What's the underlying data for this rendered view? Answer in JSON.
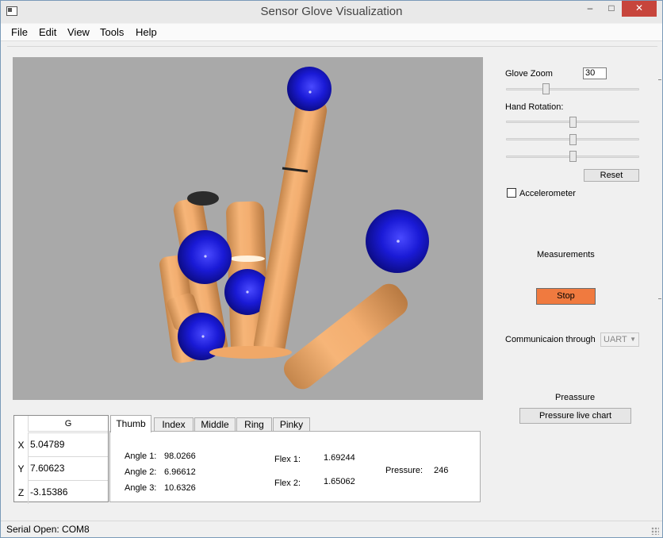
{
  "window": {
    "title": "Sensor Glove Visualization",
    "minimize": "–",
    "maximize": "□",
    "close": "✕"
  },
  "menu": {
    "items": [
      "File",
      "Edit",
      "View",
      "Tools",
      "Help"
    ]
  },
  "viewport": {
    "background_color": "#a9a9a9",
    "finger_color": "#f0a868",
    "joint_color": "#1a1ad6"
  },
  "controls": {
    "glove_zoom_label": "Glove Zoom",
    "glove_zoom_value": "30",
    "glove_zoom_level": 0.3,
    "hand_rotation_label": "Hand Rotation:",
    "rotation_levels": [
      0.5,
      0.5,
      0.5
    ],
    "reset_label": "Reset",
    "accelerometer_label": "Accelerometer",
    "accelerometer_checked": false,
    "measurements_label": "Measurements",
    "stop_label": "Stop",
    "stop_color": "#f07a3f",
    "communication_label": "Communicaion through",
    "communication_value": "UART",
    "pressure_label": "Preassure",
    "pressure_chart_label": "Pressure live chart"
  },
  "g_table": {
    "header": "G",
    "rows": [
      {
        "axis": "X",
        "value": "5.04789"
      },
      {
        "axis": "Y",
        "value": "7.60623"
      },
      {
        "axis": "Z",
        "value": "-3.15386"
      }
    ]
  },
  "tabs": {
    "items": [
      "Thumb",
      "Index",
      "Middle",
      "Ring",
      "Pinky"
    ],
    "active": "Thumb"
  },
  "thumb": {
    "angle1_label": "Angle 1:",
    "angle1_value": "98.0266",
    "angle2_label": "Angle 2:",
    "angle2_value": "6.96612",
    "angle3_label": "Angle 3:",
    "angle3_value": "10.6326",
    "flex1_label": "Flex 1:",
    "flex1_value": "1.69244",
    "flex2_label": "Flex 2:",
    "flex2_value": "1.65062",
    "pressure_label": "Pressure:",
    "pressure_value": "246"
  },
  "status": {
    "text": "Serial Open: COM8"
  }
}
